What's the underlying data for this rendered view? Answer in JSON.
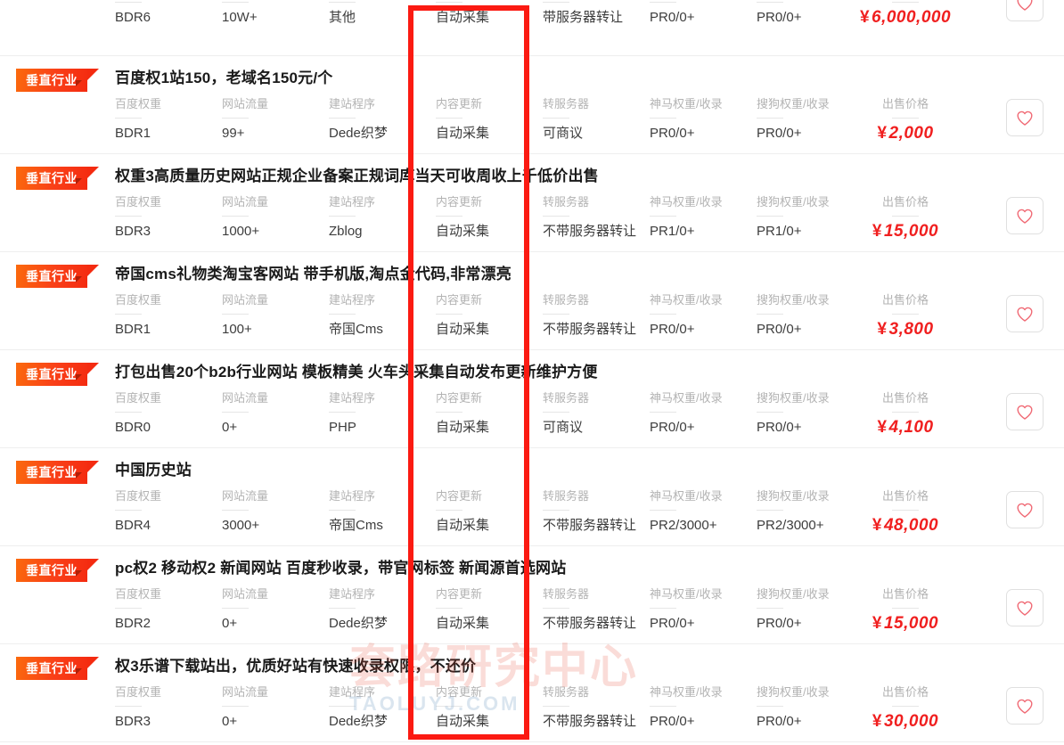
{
  "columns": {
    "baidu_weight": "百度权重",
    "traffic": "网站流量",
    "program": "建站程序",
    "content_update": "内容更新",
    "server": "转服务器",
    "shenma": "神马权重/收录",
    "sogou": "搜狗权重/收录",
    "price": "出售价格"
  },
  "badge_label": "垂直行业",
  "favorite_icon": "heart-icon",
  "annotation": {
    "name": "red-highlight-rectangle",
    "color": "#fb1a12",
    "highlights_column": "内容更新"
  },
  "watermark": {
    "main": "套路研究中心",
    "sub": "TAOLUYJ.COM"
  },
  "rows": [
    {
      "partial": true,
      "badge": "",
      "title": "",
      "baidu_weight": "BDR6",
      "traffic": "10W+",
      "program": "其他",
      "content_update": "自动采集",
      "server": "带服务器转让",
      "shenma": "PR0/0+",
      "sogou": "PR0/0+",
      "price": "6,000,000"
    },
    {
      "partial": false,
      "badge": "垂直行业",
      "title": "百度权1站150，老域名150元/个",
      "baidu_weight": "BDR1",
      "traffic": "99+",
      "program": "Dede织梦",
      "content_update": "自动采集",
      "server": "可商议",
      "shenma": "PR0/0+",
      "sogou": "PR0/0+",
      "price": "2,000"
    },
    {
      "partial": false,
      "badge": "垂直行业",
      "title": "权重3高质量历史网站正规企业备案正规词库当天可收周收上千低价出售",
      "baidu_weight": "BDR3",
      "traffic": "1000+",
      "program": "Zblog",
      "content_update": "自动采集",
      "server": "不带服务器转让",
      "shenma": "PR1/0+",
      "sogou": "PR1/0+",
      "price": "15,000"
    },
    {
      "partial": false,
      "badge": "垂直行业",
      "title": "帝国cms礼物类淘宝客网站 带手机版,淘点金代码,非常漂亮",
      "baidu_weight": "BDR1",
      "traffic": "100+",
      "program": "帝国Cms",
      "content_update": "自动采集",
      "server": "不带服务器转让",
      "shenma": "PR0/0+",
      "sogou": "PR0/0+",
      "price": "3,800"
    },
    {
      "partial": false,
      "badge": "垂直行业",
      "title": "打包出售20个b2b行业网站 模板精美 火车头采集自动发布更新维护方便",
      "baidu_weight": "BDR0",
      "traffic": "0+",
      "program": "PHP",
      "content_update": "自动采集",
      "server": "可商议",
      "shenma": "PR0/0+",
      "sogou": "PR0/0+",
      "price": "4,100"
    },
    {
      "partial": false,
      "badge": "垂直行业",
      "title": "中国历史站",
      "baidu_weight": "BDR4",
      "traffic": "3000+",
      "program": "帝国Cms",
      "content_update": "自动采集",
      "server": "不带服务器转让",
      "shenma": "PR2/3000+",
      "sogou": "PR2/3000+",
      "price": "48,000"
    },
    {
      "partial": false,
      "badge": "垂直行业",
      "title": "pc权2 移动权2 新闻网站 百度秒收录，带官网标签 新闻源首选网站",
      "baidu_weight": "BDR2",
      "traffic": "0+",
      "program": "Dede织梦",
      "content_update": "自动采集",
      "server": "不带服务器转让",
      "shenma": "PR0/0+",
      "sogou": "PR0/0+",
      "price": "15,000"
    },
    {
      "partial": false,
      "badge": "垂直行业",
      "title": "权3乐谱下载站出，优质好站有快速收录权限，不还价",
      "baidu_weight": "BDR3",
      "traffic": "0+",
      "program": "Dede织梦",
      "content_update": "自动采集",
      "server": "不带服务器转让",
      "shenma": "PR0/0+",
      "sogou": "PR0/0+",
      "price": "30,000"
    }
  ]
}
